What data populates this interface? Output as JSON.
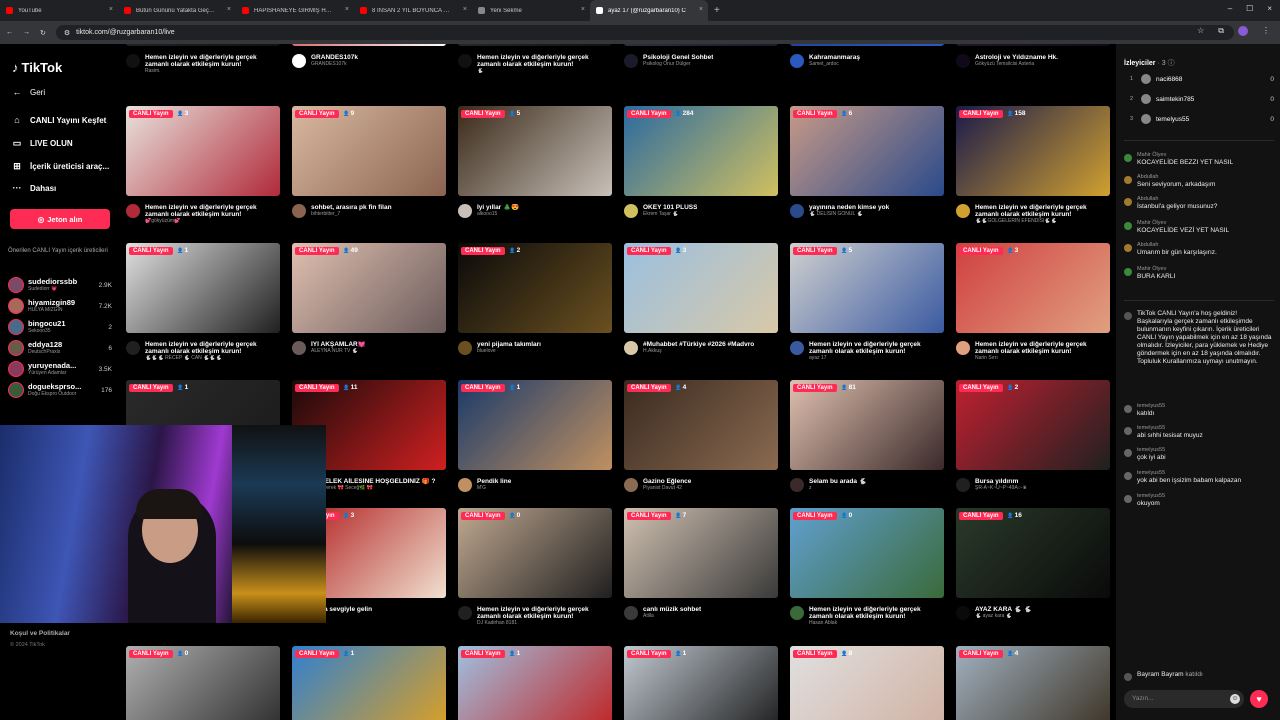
{
  "browser": {
    "tabs": [
      {
        "label": "YouTube",
        "active": false
      },
      {
        "label": "Bütün Gününü Yatakta Geçiriyor",
        "active": false
      },
      {
        "label": "HAPİSHANEYE GİRMİŞ HANIM",
        "active": false
      },
      {
        "label": "8 İNSAN 2 YIL BOYUNCA BİR N",
        "active": false
      },
      {
        "label": "Yeni Sekme",
        "active": false
      },
      {
        "label": "ayaz 17 (@ruzgarbaran10) C",
        "active": true
      }
    ],
    "new_tab": "+",
    "url": "tiktok.com/@ruzgarbaran10/live"
  },
  "sidebar": {
    "logo": "TikTok",
    "nav": [
      {
        "label": "Geri",
        "icon": "back-arrow-icon"
      },
      {
        "label": "CANLI Yayını Keşfet",
        "icon": "compass-icon"
      },
      {
        "label": "LIVE OLUN",
        "icon": "live-camera-icon"
      },
      {
        "label": "İçerik üreticisi araç...",
        "icon": "tools-icon"
      },
      {
        "label": "Dahası",
        "icon": "more-icon"
      }
    ],
    "coins_button": "Jeton alın",
    "suggested_title": "Önerilen CANLI Yayın içerik üreticileri",
    "suggested": [
      {
        "name": "sudediorssbb",
        "sub": "Sudediorr 💗",
        "count": "2.9K",
        "color": "#7a4a6a"
      },
      {
        "name": "hiyamizgin89",
        "sub": "HULYA MIZGIN",
        "count": "7.2K",
        "color": "#a56a5a"
      },
      {
        "name": "bingocu21",
        "sub": "Sekooo35",
        "count": "2",
        "color": "#4a6a8a"
      },
      {
        "name": "eddya128",
        "sub": "DeutschPraxis",
        "count": "6",
        "color": "#6a5a4a"
      },
      {
        "name": "yuruyenada...",
        "sub": "Yürüyen Adamlar",
        "count": "3.5K",
        "color": "#8a3a5a"
      },
      {
        "name": "dogueksprso...",
        "sub": "Doğu Ekspro Outdoor",
        "count": "176",
        "color": "#3a5a3a"
      }
    ],
    "footer_links": "Koşul ve Politikalar",
    "copyright": "© 2024 TikTok"
  },
  "live_badge": "CANLI Yayın",
  "grid": [
    {
      "title": "Hemen izleyin ve diğerleriyle gerçek zamanlı olarak etkileşim kurun!",
      "sub": "Rasim.",
      "viewers": "",
      "c1": "#2a2a2a",
      "c2": "#111111"
    },
    {
      "title": "GRANDES107k",
      "sub": "GRANDES107k",
      "viewers": "",
      "c1": "#c41a1a",
      "c2": "#ffffff"
    },
    {
      "title": "Hemen izleyin ve diğerleriyle gerçek zamanlı olarak etkileşim kurun!",
      "sub": "🐇",
      "viewers": "",
      "c1": "#333333",
      "c2": "#111111"
    },
    {
      "title": "Psikoloji Genel Sohbet",
      "sub": "Psikolog Onur Dülger",
      "viewers": "",
      "c1": "#3a3a4a",
      "c2": "#1a1a2a"
    },
    {
      "title": "Kahramanmaraş",
      "sub": "Samet_ardoc",
      "viewers": "",
      "c1": "#1a3a8a",
      "c2": "#2a5ac0"
    },
    {
      "title": "Astroloji ve Yıldızname Hk.",
      "sub": "Gökyüzü Temsilcisi Asteria",
      "viewers": "",
      "c1": "#2a2030",
      "c2": "#100a18"
    },
    {
      "title": "Hemen izleyin ve diğerleriyle gerçek zamanlı olarak etkileşim kurun!",
      "sub": "💕gökyüzüm💕",
      "viewers": "3",
      "c1": "#e8e2dc",
      "c2": "#b02a3a"
    },
    {
      "title": "sohbet, arasıra pk fin filan",
      "sub": "bihterbitter_7",
      "viewers": "9",
      "c1": "#d9b8a0",
      "c2": "#8a6450"
    },
    {
      "title": "İyi yıllar 🎄😍",
      "sub": "alkooo15",
      "viewers": "5",
      "c1": "#3a2a1a",
      "c2": "#c8c0b8"
    },
    {
      "title": "OKEY 101 PLUSS",
      "sub": "Ekrem Taşar 🐇",
      "viewers": "284",
      "c1": "#2a6aa0",
      "c2": "#d0c060"
    },
    {
      "title": "yayınına neden kimse yok",
      "sub": "🐇 DELİSİN GÖNÜL 🐇",
      "viewers": "6",
      "c1": "#c89a88",
      "c2": "#2a4a8a"
    },
    {
      "title": "Hemen izleyin ve diğerleriyle gerçek zamanlı olarak etkileşim kurun!",
      "sub": "🐇🐇GÖLGELERİN EFENDİSİ🐇🐇",
      "viewers": "158",
      "c1": "#1a1a4a",
      "c2": "#d0a030"
    },
    {
      "title": "Hemen izleyin ve diğerleriyle gerçek zamanlı olarak etkileşim kurun!",
      "sub": "🐇🐇🐇 RECEP 🐇 CAN 🐇🐇🐇",
      "viewers": "1",
      "c1": "#e0e0e0",
      "c2": "#202020"
    },
    {
      "title": "İYİ AKŞAMLAR💓",
      "sub": "ALEYNA NUR TV 🐇",
      "viewers": "49",
      "c1": "#e0c0b0",
      "c2": "#6a5a5a"
    },
    {
      "title": "yeni pijama takımları",
      "sub": "bluelove",
      "viewers": "2",
      "c1": "#0a0a0a",
      "c2": "#6a5020"
    },
    {
      "title": "#Muhabbet #Türkiye #2026 #Madvro",
      "sub": "H.Akkuş",
      "viewers": "3",
      "c1": "#9ac0e0",
      "c2": "#d8c8a8"
    },
    {
      "title": "Hemen izleyin ve diğerleriyle gerçek zamanlı olarak etkileşim kurun!",
      "sub": "ayaz 17",
      "viewers": "5",
      "c1": "#d0d0d0",
      "c2": "#3a5aa0"
    },
    {
      "title": "Hemen izleyin ve diğerleriyle gerçek zamanlı olarak etkileşim kurun!",
      "sub": "Narin Sırrı",
      "viewers": "3",
      "c1": "#d04040",
      "c2": "#e0a080"
    },
    {
      "title": "",
      "sub": "",
      "viewers": "1",
      "c1": "#2a2a2a",
      "c2": "#1a1a1a"
    },
    {
      "title": "KEBELEK AİLESİNE HOŞGELDİNİZ 🎁 ?",
      "sub": "🌿 severek 🎀 Seceğ🌿 🎀",
      "viewers": "11",
      "c1": "#1a0a0a",
      "c2": "#d02020"
    },
    {
      "title": "Pendik line",
      "sub": "M'G",
      "viewers": "1",
      "c1": "#1a3a6a",
      "c2": "#c09060"
    },
    {
      "title": "Gazino Eğlence",
      "sub": "Piyanist Davut 42",
      "viewers": "4",
      "c1": "#3a2a20",
      "c2": "#8a6a50"
    },
    {
      "title": "Selam bu arada 🐇",
      "sub": "z",
      "viewers": "81",
      "c1": "#e0c0b0",
      "c2": "#3a2a2a"
    },
    {
      "title": "Bursa yıldırım",
      "sub": "ŞR-A~K~U~P~49A○-♛",
      "viewers": "2",
      "c1": "#c02030",
      "c2": "#202020"
    },
    {
      "title": "",
      "sub": "",
      "viewers": "",
      "c1": "#111111",
      "c2": "#111111"
    },
    {
      "title": "gayla sevgiyle gelin",
      "sub": "cezar",
      "viewers": "3",
      "c1": "#b01a1a",
      "c2": "#f0e0d0"
    },
    {
      "title": "Hemen izleyin ve diğerleriyle gerçek zamanlı olarak etkileşim kurun!",
      "sub": "DJ Kadirhan 8181",
      "viewers": "0",
      "c1": "#c0a890",
      "c2": "#202020"
    },
    {
      "title": "canlı müzik sohbet",
      "sub": "Atilla",
      "viewers": "7",
      "c1": "#d0c0b0",
      "c2": "#3a3a3a"
    },
    {
      "title": "Hemen izleyin ve diğerleriyle gerçek zamanlı olarak etkileşim kurun!",
      "sub": "Hasan Ablak",
      "viewers": "0",
      "c1": "#60a0d0",
      "c2": "#3a6a3a"
    },
    {
      "title": "AYAZ KARA 🐇 🐇",
      "sub": "🐇 ayaz kara 🐇",
      "viewers": "16",
      "c1": "#2a3a2a",
      "c2": "#0a0a0a"
    },
    {
      "title": "",
      "sub": "",
      "viewers": "0",
      "c1": "#b0b0b0",
      "c2": "#2a2a2a"
    },
    {
      "title": "",
      "sub": "",
      "viewers": "1",
      "c1": "#3080d0",
      "c2": "#e0a020"
    },
    {
      "title": "",
      "sub": "",
      "viewers": "1",
      "c1": "#a0c0e0",
      "c2": "#c02020"
    },
    {
      "title": "",
      "sub": "",
      "viewers": "1",
      "c1": "#c0c8d0",
      "c2": "#1a1a1a"
    },
    {
      "title": "",
      "sub": "",
      "viewers": "8",
      "c1": "#e0e0e0",
      "c2": "#d0b0a0"
    },
    {
      "title": "",
      "sub": "",
      "viewers": "4",
      "c1": "#a0b0c0",
      "c2": "#3a3020"
    }
  ],
  "chat": {
    "viewers_title": "İzleyiciler",
    "viewers_count": "· 3",
    "top_viewers": [
      {
        "rank": "1",
        "name": "naci6868",
        "score": "0"
      },
      {
        "rank": "2",
        "name": "saimtekin785",
        "score": "0"
      },
      {
        "rank": "3",
        "name": "temelyus55",
        "score": "0"
      }
    ],
    "messages": [
      {
        "user": "Mahir Ölyev",
        "text": "KOCAYELİDE BEZZI YET NASIL",
        "color": "#3a8a3a"
      },
      {
        "user": "Abdullah",
        "text": "Seni seviyorum, arkadaşım",
        "color": "#a07a30"
      },
      {
        "user": "Abdullah",
        "text": "İstanbul'a geliyor musunuz?",
        "color": "#a07a30"
      },
      {
        "user": "Mahir Ölyev",
        "text": "KOCAYELİDE VEZİ YET NASIL",
        "color": "#3a8a3a"
      },
      {
        "user": "Abdullah",
        "text": "Umarım bir gün karşılaşırız.",
        "color": "#a07a30"
      },
      {
        "user": "Mahir Ölyev",
        "text": "BURA KARLI",
        "color": "#3a8a3a"
      },
      {
        "user": "",
        "text": "TikTok CANLI Yayın'a hoş geldiniz! Başkalarıyla gerçek zamanlı etkileşimde bulunmanın keyfini çıkarın. İçerik üreticileri CANLI Yayın yapabilmek için en az 18 yaşında olmalıdır. İzleyiciler, para yüklemek ve Hediye göndermek için en az 18 yaşında olmalıdır. Topluluk Kurallarımıza uymayı unutmayın.",
        "color": "#555555"
      },
      {
        "user": "temelyus55",
        "text": "katıldı",
        "color": "#666666"
      },
      {
        "user": "temelyus55",
        "text": "abi sıhhi tesisat muyuz",
        "color": "#666666"
      },
      {
        "user": "temelyus55",
        "text": "çok iyi abi",
        "color": "#666666"
      },
      {
        "user": "temelyus55",
        "text": "yok abi ben işsizim babam kalpazan",
        "color": "#666666"
      },
      {
        "user": "temelyus55",
        "text": "okuyom",
        "color": "#666666"
      }
    ],
    "join_notice": "Bayram Bayram",
    "join_word": "katıldı",
    "input_placeholder": "Yazın..."
  }
}
